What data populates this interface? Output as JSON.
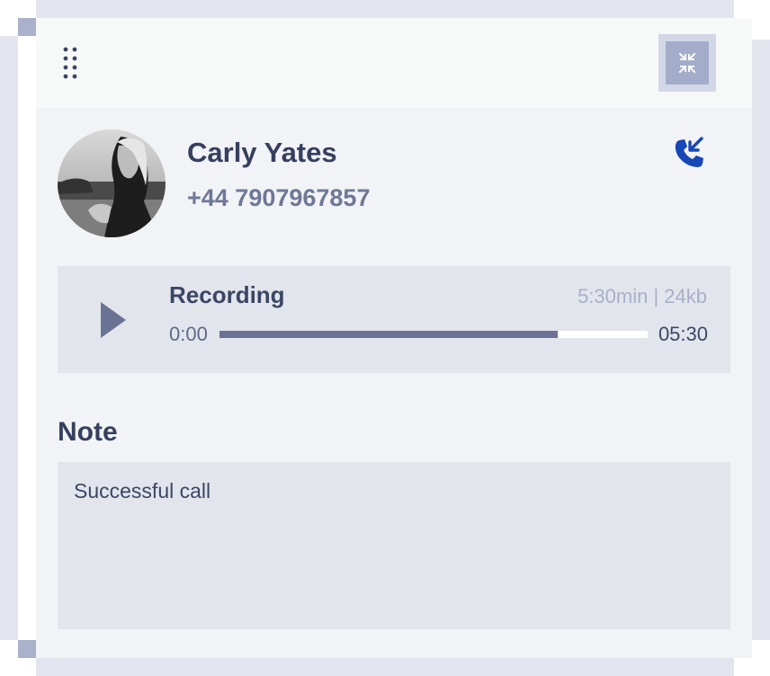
{
  "contact": {
    "name": "Carly Yates",
    "phone": "+44 7907967857"
  },
  "call": {
    "direction": "incoming",
    "icon": "incoming-call-icon",
    "color": "#1746b6"
  },
  "recording": {
    "title": "Recording",
    "meta": "5:30min | 24kb",
    "time_start": "0:00",
    "time_end": "05:30",
    "progress_fraction": 0.79
  },
  "note": {
    "label": "Note",
    "value": "Successful call"
  },
  "icons": {
    "drag": "drag-handle-icon",
    "minimize": "minimize-icon",
    "play": "play-icon"
  },
  "colors": {
    "accent": "#1746b6",
    "text_primary": "#36405e",
    "progress_fill": "#6a7393"
  }
}
